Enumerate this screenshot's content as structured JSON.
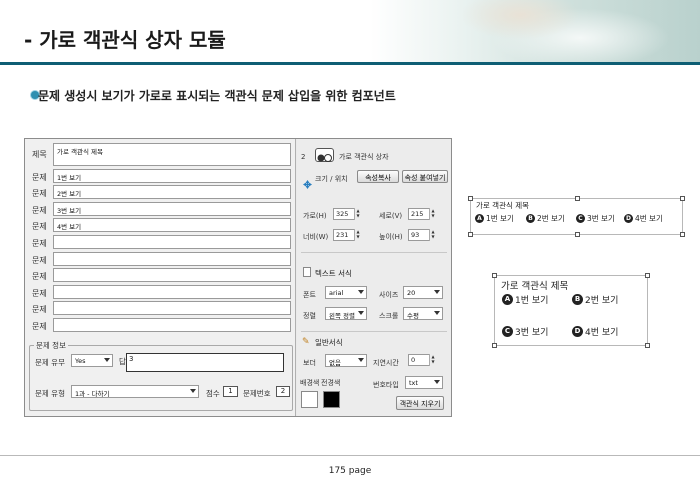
{
  "header": {
    "title": "- 가로 객관식 상자 모듈",
    "subtitle": "문제 생성시 보기가 가로로 표시되는 객관식 문제 삽입을 위한 컴포넌트",
    "accent_color": "#0e5e74"
  },
  "editor": {
    "left": {
      "title_label": "제목",
      "title_value": "가로 객관식 제목",
      "question_label": "문제",
      "choices": [
        "1번 보기",
        "2번 보기",
        "3번 보기",
        "4번 보기",
        "",
        "",
        "",
        "",
        "",
        ""
      ],
      "info_group": {
        "title": "문제 정보",
        "has_problem_label": "문제 유무",
        "has_problem_value": "Yes",
        "answer_label": "답",
        "answer_value": "3",
        "type_label": "문제 유형",
        "type_value": "1과 - 다하기",
        "score_label": "점수",
        "score_value": "1",
        "qnum_label": "문제번호",
        "qnum_value": "2"
      }
    },
    "right": {
      "index": "2",
      "component_name": "가로 객관식 상자",
      "size_pos_label": "크기 / 위치",
      "copy_attr_btn": "속성복사",
      "paste_attr_btn": "속성 붙여넣기",
      "width_label": "가로(H)",
      "width_value": "325",
      "height_label": "세로(V)",
      "height_value": "215",
      "w_label": "너비(W)",
      "w_value": "231",
      "h_label": "높이(H)",
      "h_value": "93",
      "text_format_title": "텍스트 서식",
      "font_label": "폰트",
      "font_value": "arial",
      "size_label": "사이즈",
      "size_value": "20",
      "align_label": "정렬",
      "align_value": "왼쪽 정렬",
      "scroll_label": "스크롤",
      "scroll_value": "수평",
      "general_title": "일반서식",
      "border_label": "보더",
      "border_value": "없음",
      "delay_label": "지연시간",
      "delay_value": "0",
      "bg_label": "배경색",
      "fg_label": "전경색",
      "numtype_label": "번호타입",
      "numtype_value": "txt",
      "delete_btn": "객관식 지우기",
      "bg_color": "#ffffff",
      "fg_color": "#000000"
    }
  },
  "preview": {
    "title": "가로 객관식 제목",
    "options": [
      {
        "mark": "A",
        "label": "1번 보기"
      },
      {
        "mark": "B",
        "label": "2번 보기"
      },
      {
        "mark": "C",
        "label": "3번 보기"
      },
      {
        "mark": "D",
        "label": "4번 보기"
      }
    ]
  },
  "footer": {
    "page_label": "175 page"
  }
}
